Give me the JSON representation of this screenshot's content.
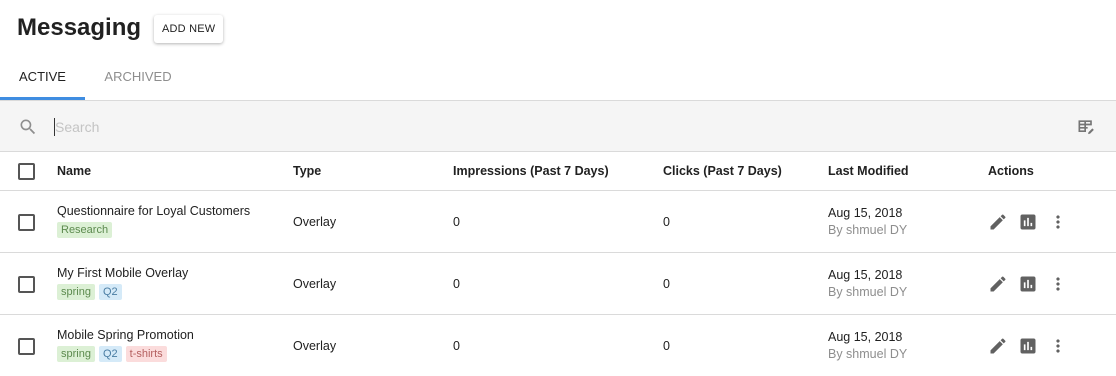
{
  "page": {
    "title": "Messaging",
    "add_button": "ADD NEW"
  },
  "tabs": [
    {
      "label": "ACTIVE",
      "active": true
    },
    {
      "label": "ARCHIVED",
      "active": false
    }
  ],
  "search": {
    "placeholder": "Search",
    "value": ""
  },
  "table": {
    "columns": [
      "Name",
      "Type",
      "Impressions (Past 7 Days)",
      "Clicks (Past 7 Days)",
      "Last Modified",
      "Actions"
    ],
    "rows": [
      {
        "name": "Questionnaire for Loyal Customers",
        "tags": [
          {
            "label": "Research",
            "color": "green"
          }
        ],
        "type": "Overlay",
        "impressions": "0",
        "clicks": "0",
        "modified_date": "Aug 15, 2018",
        "modified_by": "By shmuel DY"
      },
      {
        "name": "My First Mobile Overlay",
        "tags": [
          {
            "label": "spring",
            "color": "green"
          },
          {
            "label": "Q2",
            "color": "blue"
          }
        ],
        "type": "Overlay",
        "impressions": "0",
        "clicks": "0",
        "modified_date": "Aug 15, 2018",
        "modified_by": "By shmuel DY"
      },
      {
        "name": "Mobile Spring Promotion",
        "tags": [
          {
            "label": "spring",
            "color": "green"
          },
          {
            "label": "Q2",
            "color": "blue"
          },
          {
            "label": "t-shirts",
            "color": "red"
          }
        ],
        "type": "Overlay",
        "impressions": "0",
        "clicks": "0",
        "modified_date": "Aug 15, 2018",
        "modified_by": "By shmuel DY"
      }
    ]
  },
  "icons": {
    "search": "search-icon",
    "columns": "table-edit-icon",
    "edit": "pencil-icon",
    "stats": "bar-chart-icon",
    "more": "more-vert-icon"
  },
  "colors": {
    "accent": "#3f8de1"
  }
}
